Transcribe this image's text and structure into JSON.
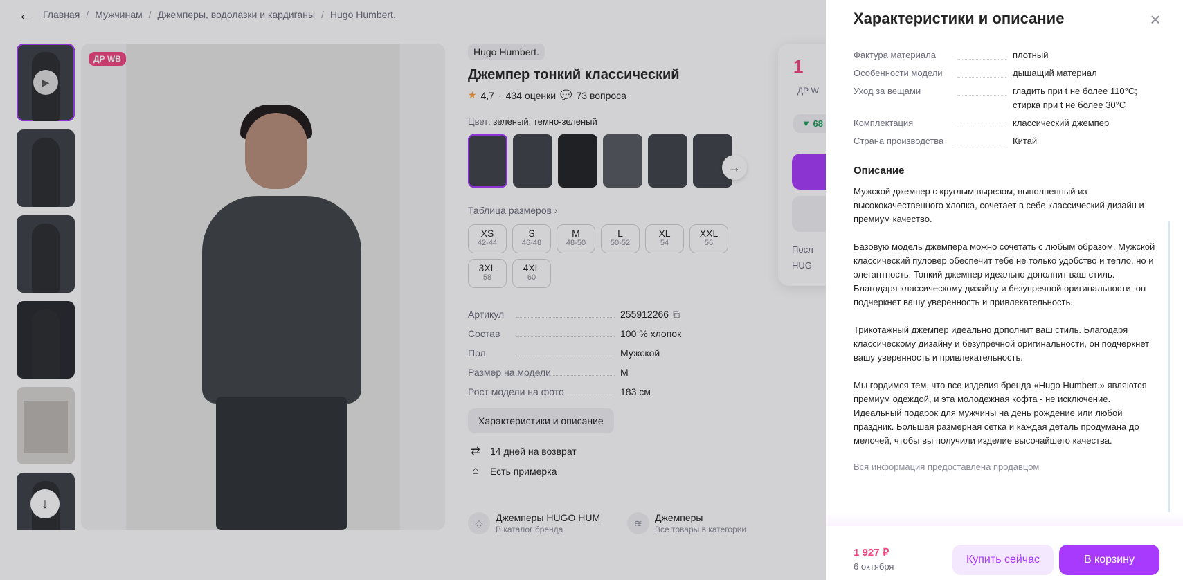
{
  "breadcrumbs": {
    "back_icon": "arrow-left-icon",
    "items": [
      "Главная",
      "Мужчинам",
      "Джемперы, водолазки и кардиганы",
      "Hugo Humbert."
    ],
    "separator": "/"
  },
  "gallery": {
    "promo_badge": "ДР WB",
    "thumbnail_count": 6,
    "active_thumbnail": 1
  },
  "product": {
    "brand": "Hugo Humbert.",
    "title": "Джемпер тонкий классический",
    "rating": "4,7",
    "dot": "·",
    "reviews": "434 оценки",
    "questions": "73 вопроса",
    "color_label": "Цвет:",
    "color_value": "зеленый, темно-зеленый",
    "size_table_label": "Таблица размеров ›",
    "sizes": [
      {
        "size": "XS",
        "ru": "42-44"
      },
      {
        "size": "S",
        "ru": "46-48"
      },
      {
        "size": "M",
        "ru": "48-50"
      },
      {
        "size": "L",
        "ru": "50-52"
      },
      {
        "size": "XL",
        "ru": "54"
      },
      {
        "size": "XXL",
        "ru": "56"
      },
      {
        "size": "3XL",
        "ru": "58"
      },
      {
        "size": "4XL",
        "ru": "60"
      }
    ],
    "specs": [
      {
        "k": "Артикул",
        "v": "255912266"
      },
      {
        "k": "Состав",
        "v": "100 % хлопок"
      },
      {
        "k": "Пол",
        "v": "Мужской"
      },
      {
        "k": "Размер на модели",
        "v": "M"
      },
      {
        "k": "Рост модели на фото",
        "v": "183 см"
      }
    ],
    "char_button": "Характеристики и описание",
    "return_text": "14 дней на возврат",
    "fitting_text": "Есть примерка",
    "catalog_links": [
      {
        "title": "Джемперы HUGO HUM",
        "sub": "В каталог бренда"
      },
      {
        "title": "Джемперы",
        "sub": "Все товары в категории"
      }
    ]
  },
  "price_card": {
    "big": "1",
    "dr": "ДР W",
    "green": "▼ 68",
    "line1": "Посл",
    "line2": "HUG"
  },
  "panel": {
    "title": "Характеристики и описание",
    "specs": [
      {
        "k": "Фактура материала",
        "v": "плотный"
      },
      {
        "k": "Особенности модели",
        "v": "дышащий материал"
      },
      {
        "k": "Уход за вещами",
        "v": "гладить при t не более 110°C;\nстирка при t не более 30°C"
      },
      {
        "k": "Комплектация",
        "v": "классический джемпер"
      },
      {
        "k": "Страна производства",
        "v": "Китай"
      }
    ],
    "description_heading": "Описание",
    "paragraphs": [
      "Мужской джемпер с круглым вырезом, выполненный из высококачественного хлопка, сочетает в себе классический дизайн и премиум качество.",
      "Базовую модель джемпера можно сочетать с любым образом. Мужской классический пуловер обеспечит тебе не только удобство и тепло, но и элегантность. Тонкий джемпер идеально дополнит ваш стиль. Благодаря классическому дизайну и безупречной оригинальности, он подчеркнет вашу уверенность и привлекательность.",
      "Трикотажный джемпер идеально дополнит ваш стиль. Благодаря классическому дизайну и безупречной оригинальности, он подчеркнет вашу уверенность и привлекательность.",
      "Мы гордимся тем, что все изделия бренда «Hugo Humbert.» являются премиум одеждой, и эта молодежная кофта - не исключение. Идеальный подарок для мужчины на день рождение или любой праздник. Большая размерная сетка и каждая деталь продумана до мелочей, чтобы вы получили изделие высочайшего качества."
    ],
    "vendor_note": "Вся информация предоставлена продавцом",
    "footer": {
      "price": "1 927 ₽",
      "date": "6 октября",
      "buy_now": "Купить сейчас",
      "to_cart": "В корзину"
    }
  },
  "colors": {
    "accent": "#a73afd",
    "price": "#f0447f",
    "overlay": "rgba(28,28,38,0.2)"
  }
}
